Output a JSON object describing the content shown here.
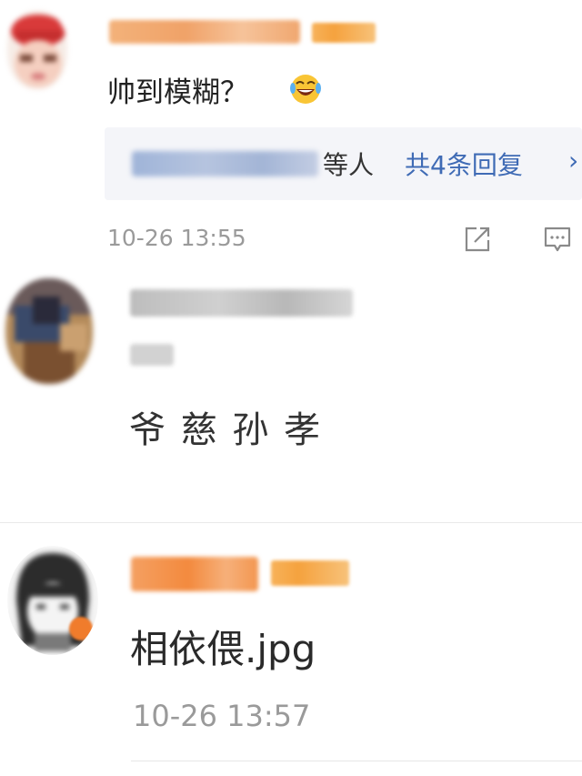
{
  "colors": {
    "accent_blue": "#3f6bb5",
    "username_orange": "#f07c2c",
    "text_main": "#222222",
    "time_gray": "#9a9a9a"
  },
  "comments": [
    {
      "text": "帅到模糊？",
      "emoji_icon": "laughing-tears-icon",
      "replies": {
        "suffix": "等人",
        "count_label": "共4条回复",
        "chevron": "›"
      },
      "time": "10-26 13:55",
      "actions": [
        "share-icon",
        "comment-icon"
      ]
    },
    {
      "text": "爷 慈 孙 孝"
    },
    {
      "text": "相依偎.jpg",
      "time": "10-26 13:57"
    }
  ]
}
